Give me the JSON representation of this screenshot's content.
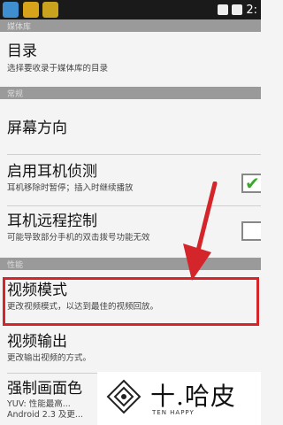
{
  "status_bar": {
    "clock": "2:"
  },
  "sections": [
    {
      "label": "媒体库"
    },
    {
      "label": "常规"
    },
    {
      "label": "性能"
    }
  ],
  "items": [
    {
      "title": "目录",
      "subtitle": "选择要收录于媒体库的目录"
    },
    {
      "title": "屏幕方向",
      "subtitle": ""
    },
    {
      "title": "启用耳机侦测",
      "subtitle": "耳机移除时暂停；插入时继续播放",
      "checked": true
    },
    {
      "title": "耳机远程控制",
      "subtitle": "可能导致部分手机的双击拨号功能无效",
      "checked": false
    },
    {
      "title": "视频模式",
      "subtitle": "更改视频模式，以达到最佳的视频回放。"
    },
    {
      "title": "视频输出",
      "subtitle": "更改输出视频的方式。"
    },
    {
      "title": "强制画面色",
      "subtitle": "YUV: 性能最高...",
      "subtitle2": "Android 2.3 及更..."
    }
  ],
  "watermark": {
    "text": "十.哈皮",
    "sub": "TEN HAPPY"
  },
  "colors": {
    "highlight": "#d4252b",
    "section_bg": "#9a9a9a",
    "check": "#3aa82c"
  }
}
